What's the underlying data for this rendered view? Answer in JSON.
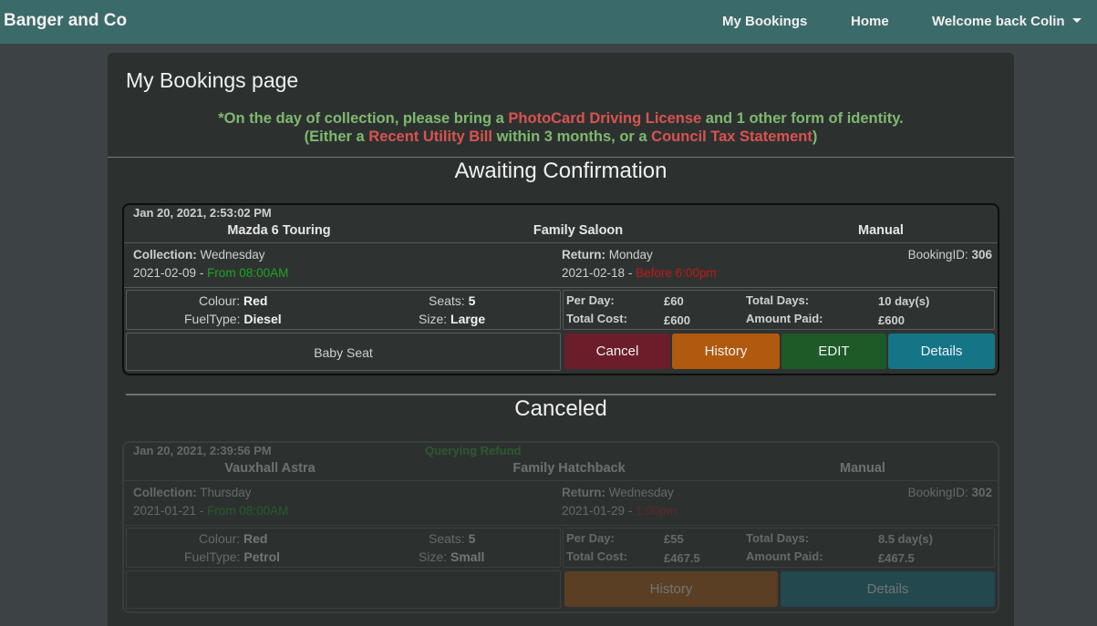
{
  "nav": {
    "brand": "Banger and Co",
    "my_bookings": "My Bookings",
    "home": "Home",
    "user_menu": "Welcome back Colin"
  },
  "page": {
    "title": "My Bookings page",
    "notice": {
      "p1": "*On the day of collection, please bring a ",
      "h1": "PhotoCard Driving License",
      "p2": " and 1 other form of identity.",
      "p3": "(Either a ",
      "h2": "Recent Utility Bill",
      "p4": " within 3 months, or a ",
      "h3": "Council Tax Statement",
      "p5": ")"
    }
  },
  "sections": {
    "awaiting": "Awaiting Confirmation",
    "canceled": "Canceled"
  },
  "labels": {
    "collection": "Collection:",
    "return": "Return:",
    "booking_id": "BookingID:",
    "colour": "Colour:",
    "fuel": "FuelType:",
    "seats": "Seats:",
    "size": "Size:",
    "per_day": "Per Day:",
    "total_cost": "Total Cost:",
    "total_days": "Total Days:",
    "amount_paid": "Amount Paid:",
    "dash": " - "
  },
  "bookings": [
    {
      "timestamp": "Jan 20, 2021, 2:53:02 PM",
      "status": "",
      "car": "Mazda 6 Touring",
      "category": "Family Saloon",
      "transmission": "Manual",
      "collection_day": "Wednesday",
      "collection_date": "2021-02-09",
      "collection_time": "From 08:00AM",
      "return_day": "Monday",
      "return_date": "2021-02-18",
      "return_time": "Before 6:00pm",
      "booking_id": "306",
      "colour": "Red",
      "fuel": "Diesel",
      "seats": "5",
      "size": "Large",
      "per_day": "£60",
      "total_cost": "£600",
      "total_days": "10 day(s)",
      "amount_paid": "£600",
      "extras": "Baby Seat",
      "buttons": {
        "cancel": "Cancel",
        "history": "History",
        "edit": "EDIT",
        "details": "Details"
      }
    },
    {
      "timestamp": "Jan 20, 2021, 2:39:56 PM",
      "status": "Querying Refund",
      "car": "Vauxhall Astra",
      "category": "Family Hatchback",
      "transmission": "Manual",
      "collection_day": "Thursday",
      "collection_date": "2021-01-21",
      "collection_time": "From 08:00AM",
      "return_day": "Wednesday",
      "return_date": "2021-01-29",
      "return_time": "1:00pm",
      "booking_id": "302",
      "colour": "Red",
      "fuel": "Petrol",
      "seats": "5",
      "size": "Small",
      "per_day": "£55",
      "total_cost": "£467.5",
      "total_days": "8.5 day(s)",
      "amount_paid": "£467.5",
      "extras": "",
      "buttons": {
        "history": "History",
        "details": "Details"
      }
    }
  ]
}
